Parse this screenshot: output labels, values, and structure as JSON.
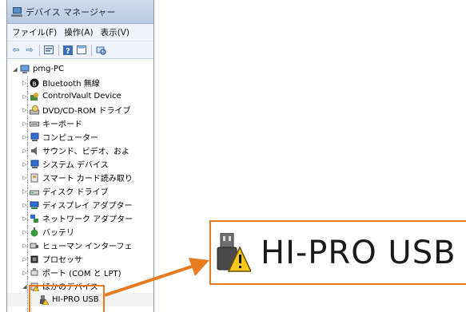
{
  "window": {
    "title": "デバイス マネージャー",
    "menu": [
      "ファイル(F)",
      "操作(A)",
      "表示(V)"
    ]
  },
  "toolbar": {
    "buttons": [
      "back-icon",
      "forward-icon",
      "properties-icon",
      "help-icon",
      "show-hidden-icon",
      "scan-icon"
    ]
  },
  "tree": {
    "root": "pmg-PC",
    "items": [
      {
        "label": "Bluetooth 無線",
        "icon": "bluetooth-icon"
      },
      {
        "label": "ControlVault Device",
        "icon": "security-device-icon"
      },
      {
        "label": "DVD/CD-ROM ドライブ",
        "icon": "dvd-drive-icon"
      },
      {
        "label": "キーボード",
        "icon": "keyboard-icon"
      },
      {
        "label": "コンピューター",
        "icon": "computer-icon"
      },
      {
        "label": "サウンド、ビデオ、およ",
        "icon": "speaker-icon"
      },
      {
        "label": "システム デバイス",
        "icon": "system-device-icon"
      },
      {
        "label": "スマート カード読み取り",
        "icon": "smart-card-icon"
      },
      {
        "label": "ディスク ドライブ",
        "icon": "disk-drive-icon"
      },
      {
        "label": "ディスプレイ アダプター",
        "icon": "display-adapter-icon"
      },
      {
        "label": "ネットワーク アダプター",
        "icon": "network-adapter-icon"
      },
      {
        "label": "バッテリ",
        "icon": "battery-icon"
      },
      {
        "label": "ヒューマン インターフェ",
        "icon": "hid-icon"
      },
      {
        "label": "プロセッサ",
        "icon": "processor-icon"
      },
      {
        "label": "ポート (COM と LPT)",
        "icon": "port-icon"
      },
      {
        "label": "ほかのデバイス",
        "icon": "other-devices-icon"
      }
    ],
    "child": {
      "label": "HI-PRO USB",
      "icon": "usb-warning-icon"
    }
  },
  "callout": {
    "label": "HI-PRO USB",
    "accent": "#e87b22"
  }
}
